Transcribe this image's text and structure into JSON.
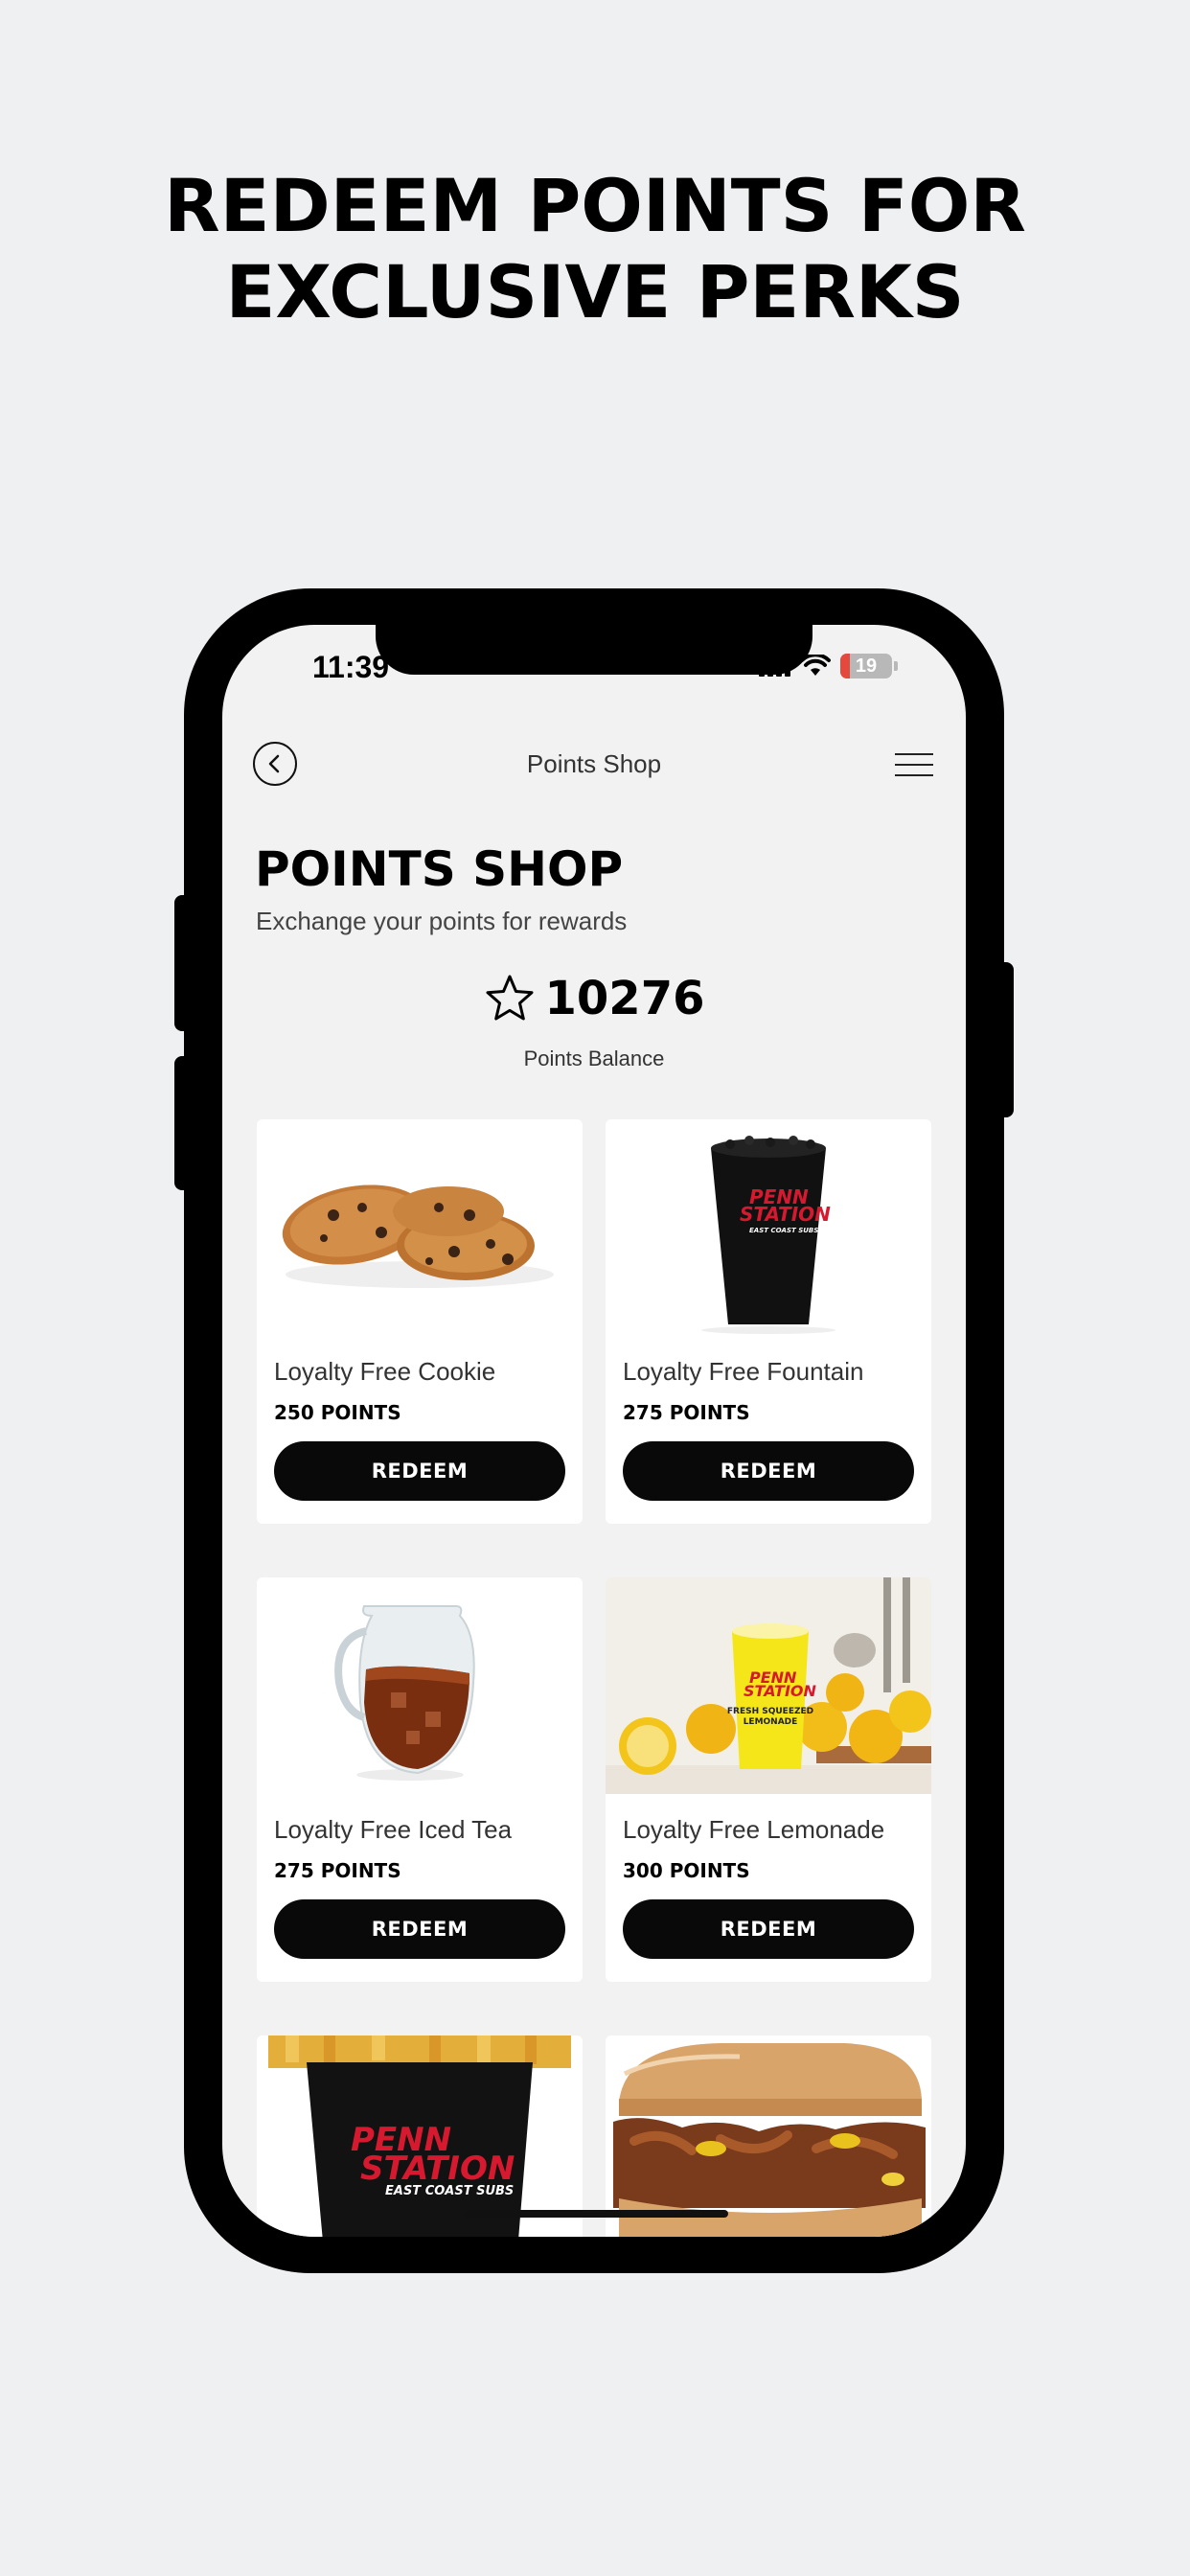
{
  "headline": {
    "line1": "REDEEM POINTS FOR",
    "line2": "EXCLUSIVE PERKS"
  },
  "status_bar": {
    "time": "11:39",
    "battery": "19"
  },
  "nav": {
    "title": "Points Shop",
    "back_icon": "chevron-left-icon",
    "menu_icon": "hamburger-menu-icon"
  },
  "page": {
    "title": "POINTS SHOP",
    "subtitle": "Exchange your points for rewards",
    "balance_value": "10276",
    "balance_label": "Points Balance"
  },
  "rewards": [
    {
      "name": "Loyalty Free Cookie",
      "points": "250 POINTS",
      "button": "REDEEM",
      "image": "cookies"
    },
    {
      "name": "Loyalty Free Fountain",
      "points": "275 POINTS",
      "button": "REDEEM",
      "image": "fountain-cup"
    },
    {
      "name": "Loyalty Free Iced Tea",
      "points": "275 POINTS",
      "button": "REDEEM",
      "image": "iced-tea-pitcher"
    },
    {
      "name": "Loyalty Free Lemonade",
      "points": "300 POINTS",
      "button": "REDEEM",
      "image": "lemonade-cup"
    },
    {
      "name": "",
      "points": "",
      "button": "",
      "image": "fries-cup"
    },
    {
      "name": "",
      "points": "",
      "button": "",
      "image": "sub-sandwich"
    }
  ],
  "brand": {
    "logo_line1": "PENN",
    "logo_line2": "STATION",
    "logo_line3": "EAST COAST SUBS",
    "lemonade_label1": "FRESH SQUEEZED",
    "lemonade_label2": "LEMONADE"
  },
  "colors": {
    "background": "#eff0f2",
    "button": "#09090a",
    "brand_red": "#d7192f",
    "lemon_yellow": "#f4e619"
  }
}
